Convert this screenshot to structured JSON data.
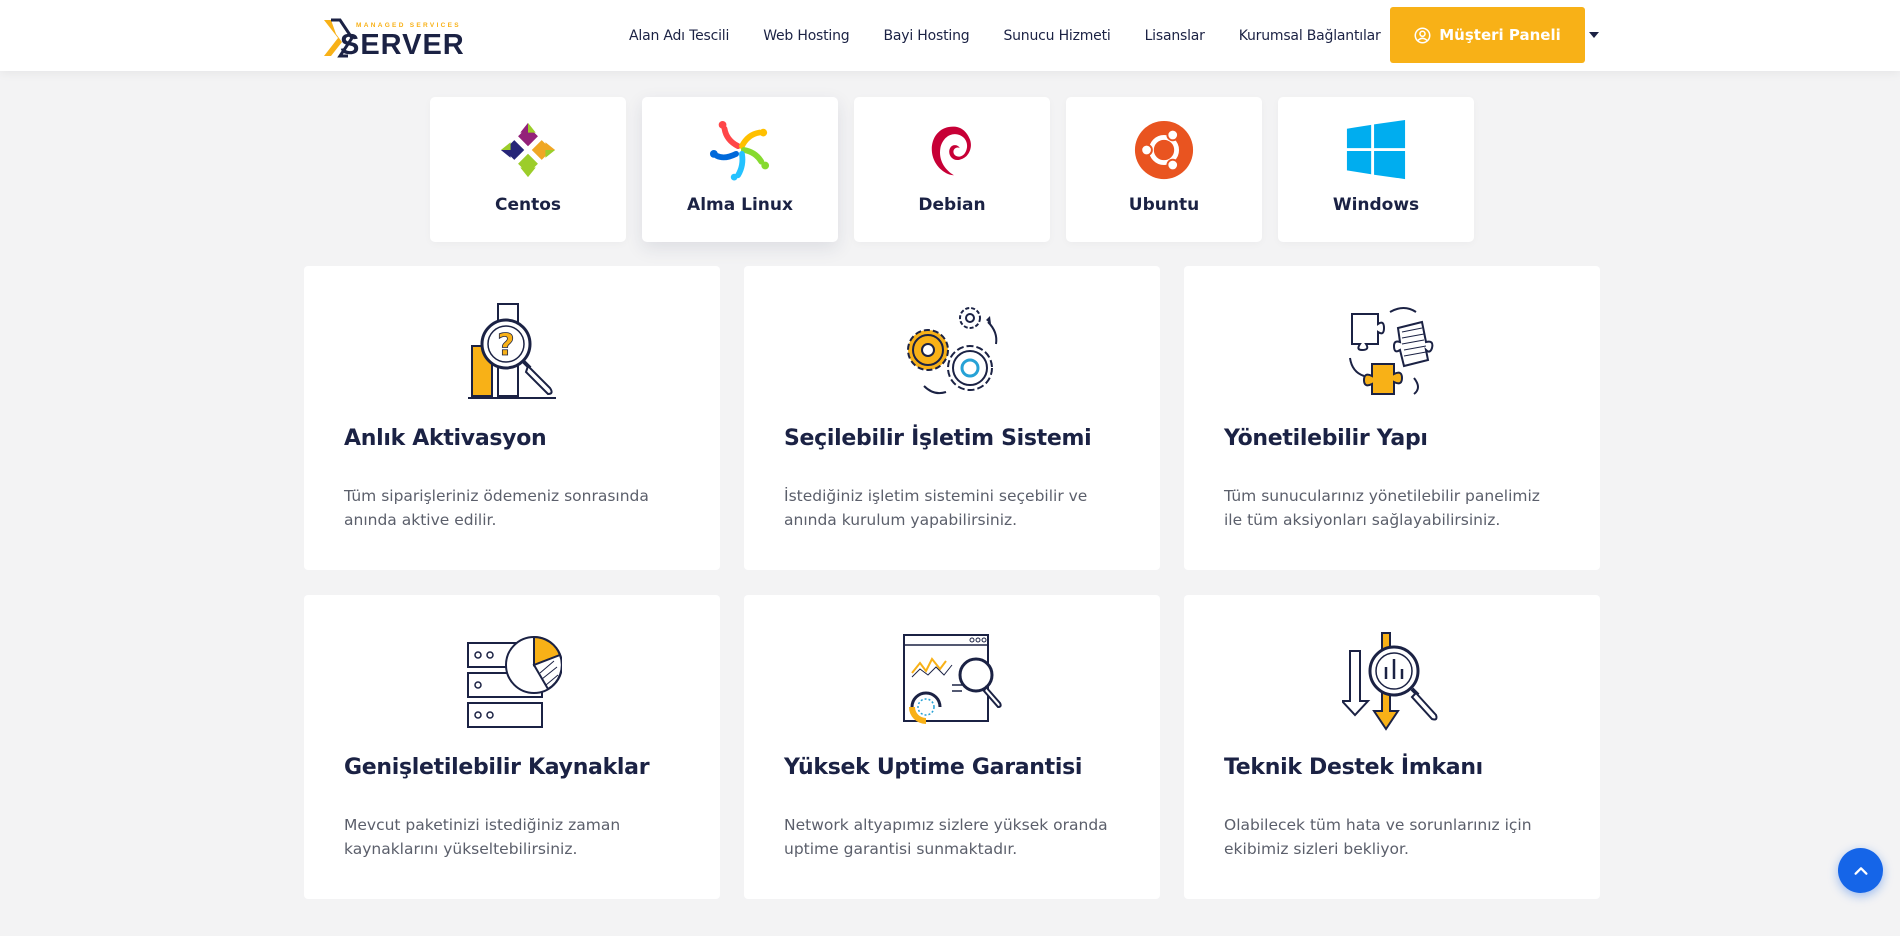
{
  "header": {
    "logo_text": "SERVER",
    "logo_tagline": "MANAGED SERVICES",
    "nav": [
      "Alan Adı Tescili",
      "Web Hosting",
      "Bayi Hosting",
      "Sunucu Hizmeti",
      "Lisanslar",
      "Kurumsal Bağlantılar"
    ],
    "panel_button": "Müşteri Paneli",
    "brand_color": "#f8b117"
  },
  "os_options": [
    {
      "name": "Centos",
      "icon": "centos-icon"
    },
    {
      "name": "Alma Linux",
      "icon": "almalinux-icon"
    },
    {
      "name": "Debian",
      "icon": "debian-icon"
    },
    {
      "name": "Ubuntu",
      "icon": "ubuntu-icon"
    },
    {
      "name": "Windows",
      "icon": "windows-icon"
    }
  ],
  "features": [
    {
      "title": "Anlık Aktivasyon",
      "desc": "Tüm siparişleriniz ödemeniz sonrasında anında aktive edilir.",
      "icon": "magnifier-question-icon"
    },
    {
      "title": "Seçilebilir İşletim Sistemi",
      "desc": "İstediğiniz işletim sistemini seçebilir ve anında kurulum yapabilirsiniz.",
      "icon": "gears-icon"
    },
    {
      "title": "Yönetilebilir Yapı",
      "desc": "Tüm sunucularınız yönetilebilir panelimiz ile tüm aksiyonları sağlayabilirsiniz.",
      "icon": "puzzle-icon"
    },
    {
      "title": "Genişletilebilir Kaynaklar",
      "desc": "Mevcut paketinizi istediğiniz zaman kaynaklarını yükseltebilirsiniz.",
      "icon": "server-chart-icon"
    },
    {
      "title": "Yüksek Uptime Garantisi",
      "desc": "Network altyapımız sizlere yüksek oranda uptime garantisi sunmaktadır.",
      "icon": "dashboard-analytics-icon"
    },
    {
      "title": "Teknik Destek İmkanı",
      "desc": "Olabilecek tüm hata ve sorunlarınız için ekibimiz sizleri bekliyor.",
      "icon": "support-analysis-icon"
    }
  ],
  "colors": {
    "accent": "#f8b117",
    "dark": "#1b2244",
    "scroll_button": "#1565e8"
  }
}
